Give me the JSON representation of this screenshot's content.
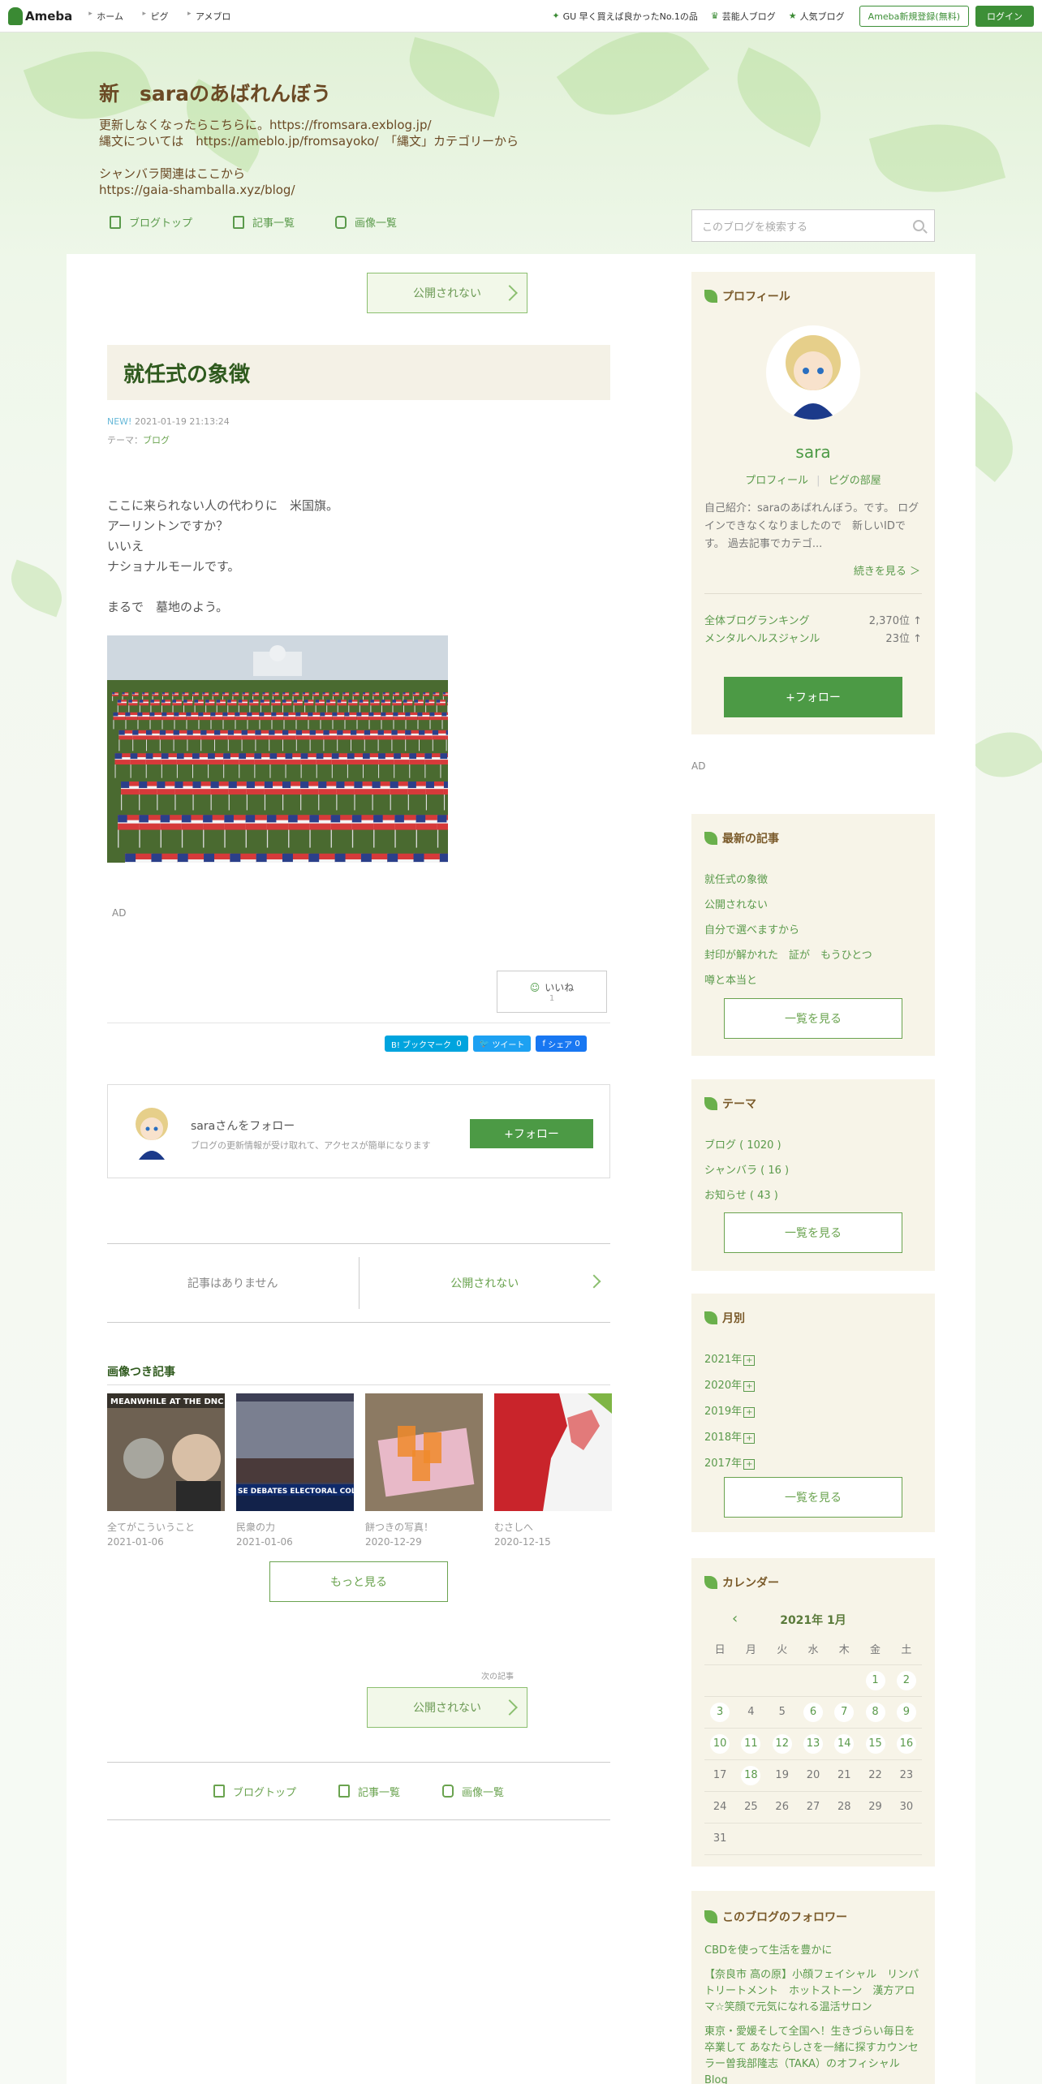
{
  "topbar": {
    "logo": "Ameba",
    "nav": [
      "ホーム",
      "ピグ",
      "アメブロ"
    ],
    "ad_text": "GU 早く買えば良かったNo.1の品",
    "celebrity": "芸能人ブログ",
    "popular": "人気ブログ",
    "register": "Ameba新規登録(無料)",
    "login": "ログイン"
  },
  "blog": {
    "title": "新　saraのあばれんぼう",
    "description": "更新しなくなったらこちらに。https://fromsara.exblog.jp/\n縄文については　https://ameblo.jp/fromsayoko/　「縄文」カテゴリーから\n\nシャンバラ関連はここから\nhttps://gaia-shamballa.xyz/blog/",
    "nav": [
      "ブログトップ",
      "記事一覧",
      "画像一覧"
    ],
    "search_placeholder": "このブログを検索する"
  },
  "entry": {
    "prev_label": "公開されない",
    "title": "就任式の象徴",
    "new_badge": "NEW!",
    "datetime": "2021-01-19 21:13:24",
    "theme_label": "テーマ：",
    "theme": "ブログ",
    "body": "ここに来られない人の代わりに　米国旗。\nアーリントンですか？\nいいえ\nナショナルモールです。\n\nまるで　墓地のよう。",
    "ad": "AD",
    "like_label": "いいね",
    "like_count": "1",
    "share": {
      "hatena": "B! ブックマーク",
      "hatena_count": "0",
      "tweet": "ツイート",
      "fb": "シェア",
      "fb_count": "0"
    },
    "follow_title": "saraさんをフォロー",
    "follow_sub": "ブログの更新情報が受け取れて、アクセスが簡単になります",
    "follow_btn": "+フォロー",
    "pager_left": "記事はありません",
    "pager_right": "公開されない",
    "image_section": "画像つき記事",
    "thumbs": [
      {
        "title": "全てがこういうこと",
        "date": "2021-01-06"
      },
      {
        "title": "民衆の力",
        "date": "2021-01-06"
      },
      {
        "title": "餅つきの写真！",
        "date": "2020-12-29"
      },
      {
        "title": "むさしへ",
        "date": "2020-12-15"
      }
    ],
    "thumb_caption_1": "MEANWHILE AT THE DNC",
    "thumb_caption_2": "SE DEBATES ELECTORAL COLLEGE OB",
    "more_btn": "もっと見る",
    "next_label_small": "次の記事",
    "next_label": "公開されない",
    "bottom_nav": [
      "ブログトップ",
      "記事一覧",
      "画像一覧"
    ]
  },
  "sidebar": {
    "profile": {
      "heading": "プロフィール",
      "name": "sara",
      "links": [
        "プロフィール",
        "ピグの部屋"
      ],
      "intro": "自己紹介：saraのあばれんぼう。です。 ログインできなくなりましたので　新しいIDです。 過去記事でカテゴ...",
      "continue": "続きを見る ＞",
      "rank1_label": "全体ブログランキング",
      "rank1_value": "2,370位 ↑",
      "rank2_label": "メンタルヘルスジャンル",
      "rank2_value": "23位 ↑",
      "follow_btn": "+フォロー"
    },
    "ad": "AD",
    "latest": {
      "heading": "最新の記事",
      "items": [
        "就任式の象徴",
        "公開されない",
        "自分で選べますから",
        "封印が解かれた　証が　もうひとつ",
        "噂と本当と"
      ],
      "see_all": "一覧を見る"
    },
    "theme": {
      "heading": "テーマ",
      "items": [
        "ブログ ( 1020 )",
        "シャンバラ ( 16 )",
        "お知らせ ( 43 )"
      ],
      "see_all": "一覧を見る"
    },
    "monthly": {
      "heading": "月別",
      "items": [
        "2021年",
        "2020年",
        "2019年",
        "2018年",
        "2017年"
      ],
      "see_all": "一覧を見る"
    },
    "calendar": {
      "heading": "カレンダー",
      "month": "2021年 1月",
      "weekdays": [
        "日",
        "月",
        "火",
        "水",
        "木",
        "金",
        "土"
      ],
      "weeks": [
        [
          "",
          "",
          "",
          "",
          "",
          "1",
          "2"
        ],
        [
          "3",
          "4",
          "5",
          "6",
          "7",
          "8",
          "9"
        ],
        [
          "10",
          "11",
          "12",
          "13",
          "14",
          "15",
          "16"
        ],
        [
          "17",
          "18",
          "19",
          "20",
          "21",
          "22",
          "23"
        ],
        [
          "24",
          "25",
          "26",
          "27",
          "28",
          "29",
          "30"
        ],
        [
          "31",
          "",
          "",
          "",
          "",
          "",
          ""
        ]
      ],
      "linked_days": [
        "1",
        "2",
        "3",
        "6",
        "7",
        "8",
        "9",
        "10",
        "11",
        "12",
        "13",
        "14",
        "15",
        "16",
        "18"
      ]
    },
    "followers": {
      "heading": "このブログのフォロワー",
      "items": [
        "CBDを使って生活を豊かに",
        "【奈良市 高の原】小顔フェイシャル　リンパトリートメント　ホットストーン　漢方アロマ☆笑顔で元気になれる温活サロン",
        "東京・愛媛そして全国へ！生きづらい毎日を卒業して あなたらしさを一緒に探すカウンセラー曽我部隆志（TAKA）のオフィシャルBlog"
      ]
    }
  }
}
